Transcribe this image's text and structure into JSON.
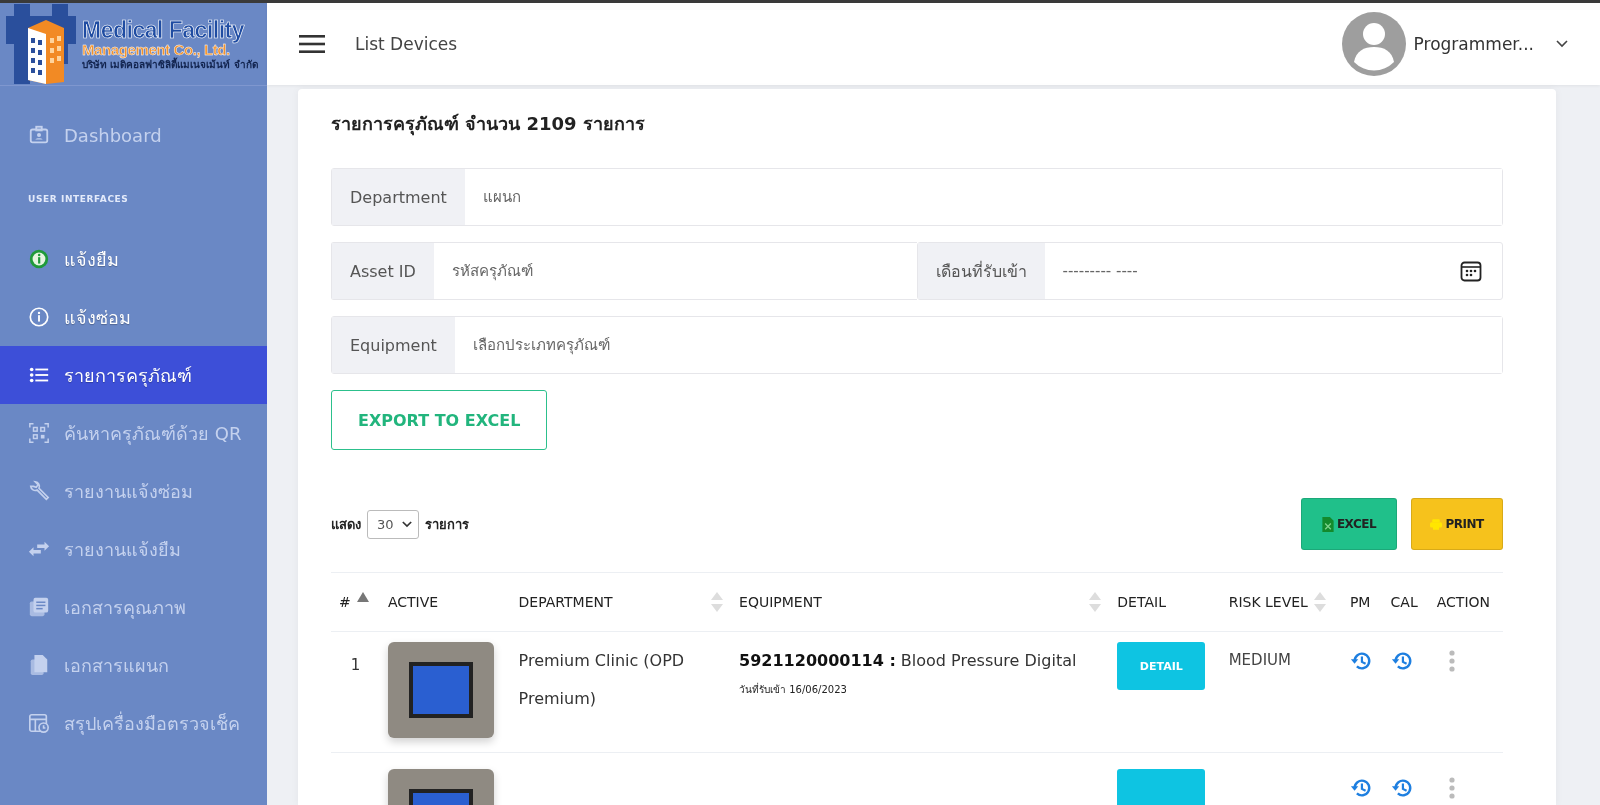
{
  "logo": {
    "title": "Medical Facility",
    "subtitle": "Management Co., Ltd.",
    "thai_name": "บริษัท เมดิคอลฟาซิลิตี้แมเนจเม้นท์ จำกัด"
  },
  "topbar": {
    "page_title": "List Devices",
    "user_name": "Programmer..."
  },
  "sidebar": {
    "items": [
      {
        "kind": "item",
        "label": "Dashboard",
        "selected": false,
        "dimmed": true
      },
      {
        "kind": "heading",
        "label": "USER INTERFACES"
      },
      {
        "kind": "item",
        "label": "แจ้งยืม",
        "selected": false,
        "dimmed": false
      },
      {
        "kind": "item",
        "label": "แจ้งซ่อม",
        "selected": false,
        "dimmed": false
      },
      {
        "kind": "item",
        "label": "รายการครุภัณฑ์",
        "selected": true,
        "dimmed": false
      },
      {
        "kind": "item",
        "label": "ค้นหาครุภัณฑ์ด้วย QR",
        "selected": false,
        "dimmed": true
      },
      {
        "kind": "item",
        "label": "รายงานแจ้งซ่อม",
        "selected": false,
        "dimmed": true
      },
      {
        "kind": "item",
        "label": "รายงานแจ้งยืม",
        "selected": false,
        "dimmed": true
      },
      {
        "kind": "item",
        "label": "เอกสารคุณภาพ",
        "selected": false,
        "dimmed": true
      },
      {
        "kind": "item",
        "label": "เอกสารแผนก",
        "selected": false,
        "dimmed": true
      },
      {
        "kind": "item",
        "label": "สรุปเครื่องมือตรวจเช็ค",
        "selected": false,
        "dimmed": true
      }
    ]
  },
  "card": {
    "title": "รายการครุภัณฑ์ จำนวน 2109 รายการ",
    "filters": {
      "department": {
        "label": "Department",
        "placeholder": "แผนก"
      },
      "asset_id": {
        "label": "Asset ID",
        "placeholder": "รหัสครุภัณฑ์"
      },
      "month": {
        "label": "เดือนที่รับเข้า",
        "placeholder": "--------- ----"
      },
      "equipment": {
        "label": "Equipment",
        "placeholder": "เลือกประเภทครุภัณฑ์"
      }
    },
    "export_button": "EXPORT TO EXCEL",
    "page_size": {
      "before": "แสดง",
      "value": "30",
      "after": "รายการ"
    },
    "excel_button": "EXCEL",
    "print_button": "PRINT",
    "table": {
      "columns": [
        {
          "label": "#",
          "sortable": true,
          "sorted": true
        },
        {
          "label": "ACTIVE",
          "sortable": false
        },
        {
          "label": "DEPARTMENT",
          "sortable": true,
          "sorted": false
        },
        {
          "label": "EQUIPMENT",
          "sortable": true,
          "sorted": false
        },
        {
          "label": "DETAIL",
          "sortable": false
        },
        {
          "label": "RISK LEVEL",
          "sortable": true,
          "sorted": false
        },
        {
          "label": "PM",
          "sortable": false
        },
        {
          "label": "CAL",
          "sortable": false
        },
        {
          "label": "ACTION",
          "sortable": false
        }
      ],
      "rows": [
        {
          "number": "1",
          "department": "Premium Clinic (OPD Premium)",
          "asset_id": "5921120000114 :",
          "equipment": "Blood Pressure Digital",
          "received": "วันที่รับเข้า 16/06/2023",
          "detail": "DETAIL",
          "risk_level": "MEDIUM"
        },
        {}
      ]
    }
  }
}
